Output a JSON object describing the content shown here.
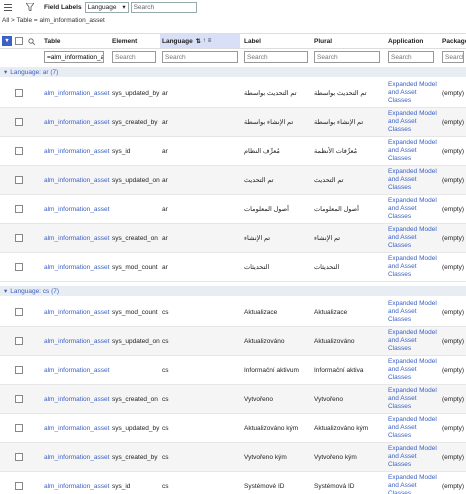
{
  "toolbar": {
    "field_labels": "Field Labels",
    "select_value": "Language",
    "search_placeholder": "Search"
  },
  "breadcrumb": "All > Table = alm_information_asset",
  "columns": [
    "Table",
    "Element",
    "Language",
    "Label",
    "Plural",
    "Application",
    "Package"
  ],
  "filters": {
    "table": "=alm_information_ar",
    "element": "Search",
    "language": "Search",
    "label": "Search",
    "plural": "Search",
    "application": "Search",
    "package": "Search"
  },
  "groups": [
    {
      "title": "Language: ar (7)",
      "rows": [
        {
          "table": "alm_information_asset",
          "element": "sys_updated_by",
          "language": "ar",
          "label": "تم التحديث بواسطة",
          "plural": "تم التحديث بواسطة",
          "app": "Expanded Model and Asset Classes",
          "package": "(empty)"
        },
        {
          "table": "alm_information_asset",
          "element": "sys_created_by",
          "language": "ar",
          "label": "تم الإنشاء بواسطة",
          "plural": "تم الإنشاء بواسطة",
          "app": "Expanded Model and Asset Classes",
          "package": "(empty)"
        },
        {
          "table": "alm_information_asset",
          "element": "sys_id",
          "language": "ar",
          "label": "مُعرِّف النظام",
          "plural": "مُعرِّفات الأنظمة",
          "app": "Expanded Model and Asset Classes",
          "package": "(empty)"
        },
        {
          "table": "alm_information_asset",
          "element": "sys_updated_on",
          "language": "ar",
          "label": "تم التحديث",
          "plural": "تم التحديث",
          "app": "Expanded Model and Asset Classes",
          "package": "(empty)"
        },
        {
          "table": "alm_information_asset",
          "element": "",
          "language": "ar",
          "label": "أصول المعلومات",
          "plural": "أصول المعلومات",
          "app": "Expanded Model and Asset Classes",
          "package": "(empty)"
        },
        {
          "table": "alm_information_asset",
          "element": "sys_created_on",
          "language": "ar",
          "label": "تم الإنشاء",
          "plural": "تم الإنشاء",
          "app": "Expanded Model and Asset Classes",
          "package": "(empty)"
        },
        {
          "table": "alm_information_asset",
          "element": "sys_mod_count",
          "language": "ar",
          "label": "التحديثات",
          "plural": "التحديثات",
          "app": "Expanded Model and Asset Classes",
          "package": "(empty)"
        }
      ]
    },
    {
      "title": "Language: cs (7)",
      "rows": [
        {
          "table": "alm_information_asset",
          "element": "sys_mod_count",
          "language": "cs",
          "label": "Aktualizace",
          "plural": "Aktualizace",
          "app": "Expanded Model and Asset Classes",
          "package": "(empty)"
        },
        {
          "table": "alm_information_asset",
          "element": "sys_updated_on",
          "language": "cs",
          "label": "Aktualizováno",
          "plural": "Aktualizováno",
          "app": "Expanded Model and Asset Classes",
          "package": "(empty)"
        },
        {
          "table": "alm_information_asset",
          "element": "",
          "language": "cs",
          "label": "Informační aktivum",
          "plural": "Informační aktiva",
          "app": "Expanded Model and Asset Classes",
          "package": "(empty)"
        },
        {
          "table": "alm_information_asset",
          "element": "sys_created_on",
          "language": "cs",
          "label": "Vytvořeno",
          "plural": "Vytvořeno",
          "app": "Expanded Model and Asset Classes",
          "package": "(empty)"
        },
        {
          "table": "alm_information_asset",
          "element": "sys_updated_by",
          "language": "cs",
          "label": "Aktualizováno kým",
          "plural": "Aktualizováno kým",
          "app": "Expanded Model and Asset Classes",
          "package": "(empty)"
        },
        {
          "table": "alm_information_asset",
          "element": "sys_created_by",
          "language": "cs",
          "label": "Vytvořeno kým",
          "plural": "Vytvořeno kým",
          "app": "Expanded Model and Asset Classes",
          "package": "(empty)"
        },
        {
          "table": "alm_information_asset",
          "element": "sys_id",
          "language": "cs",
          "label": "Systémové ID",
          "plural": "Systémová ID",
          "app": "Expanded Model and Asset Classes",
          "package": "(empty)"
        }
      ]
    }
  ],
  "icons": {
    "hamburger": "hamburger-icon",
    "filter": "filter-icon",
    "search": "search-icon",
    "sort": "sort-icon",
    "menu": "column-menu-icon"
  },
  "colors": {
    "link": "#3b61c4",
    "group_bg": "#e8ecf3",
    "active_header": "#d9dff6"
  }
}
